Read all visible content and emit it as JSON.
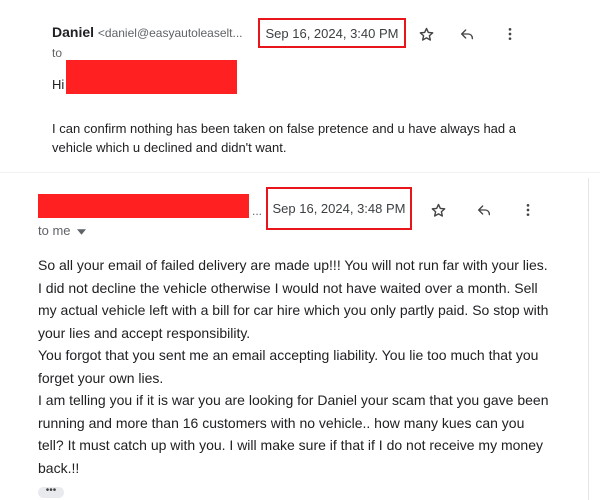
{
  "message1": {
    "sender_name": "Daniel",
    "sender_email": "<daniel@easyautoleaselt...",
    "timestamp": "Sep 16, 2024, 3:40 PM",
    "to_label": "to",
    "greeting": "Hi",
    "body": "I can confirm nothing has been taken on false pretence and u have always had a vehicle which u declined and didn't want."
  },
  "message2": {
    "ellipsis": "...",
    "timestamp": "Sep 16, 2024, 3:48 PM",
    "to_label": "to me",
    "paragraphs": [
      "So all your email of failed delivery are made up!!! You will not run far with your lies. I did not decline the vehicle otherwise I would not have waited over a month. Sell my actual vehicle left with a bill for car hire which you only partly paid. So stop with your lies and accept responsibility.",
      "You forgot that you sent me an email accepting liability. You lie too much that you forget your own lies.",
      "I am telling you if it is war you are looking for Daniel your scam that you gave been running and more than 16 customers with no vehicle.. how many kues can you tell? It must catch up with you. I will make sure if that if I do not receive my money back.!!"
    ],
    "expander": "•••"
  },
  "icons": {
    "star": "star-icon",
    "reply": "reply-icon",
    "more": "more-vert-icon",
    "dropdown": "chevron-down-icon"
  },
  "colors": {
    "highlight": "#e8151b",
    "redaction": "#ff2121"
  }
}
